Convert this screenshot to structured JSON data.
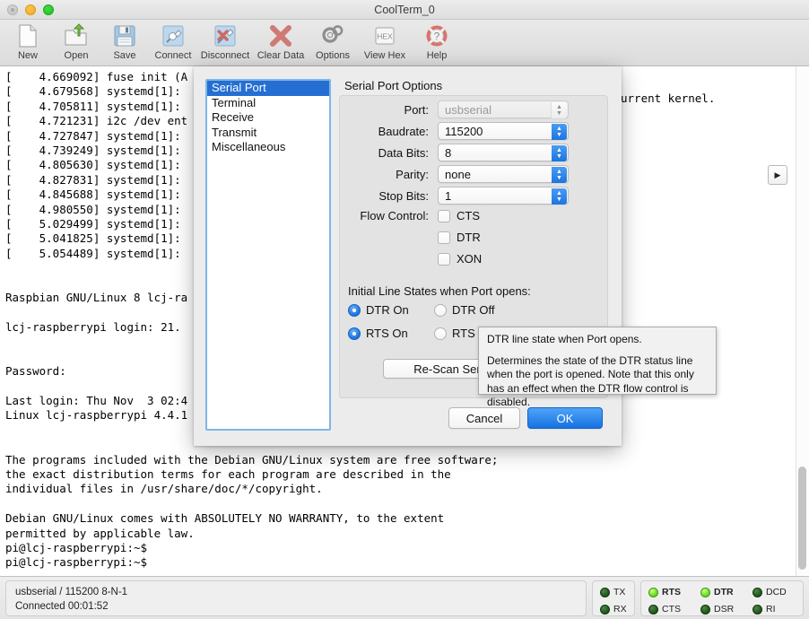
{
  "window": {
    "title": "CoolTerm_0",
    "controls": [
      "close-disabled",
      "minimize",
      "maximize"
    ]
  },
  "toolbar": {
    "items": [
      {
        "label": "New",
        "icon": "new-document-icon"
      },
      {
        "label": "Open",
        "icon": "open-folder-icon"
      },
      {
        "label": "Save",
        "icon": "floppy-disk-icon"
      },
      {
        "label": "Connect",
        "icon": "plug-connect-icon"
      },
      {
        "label": "Disconnect",
        "icon": "plug-disconnect-icon"
      },
      {
        "label": "Clear Data",
        "icon": "red-x-icon"
      },
      {
        "label": "Options",
        "icon": "gears-icon"
      },
      {
        "label": "View Hex",
        "icon": "hex-box-icon"
      },
      {
        "label": "Help",
        "icon": "lifebuoy-question-icon"
      }
    ]
  },
  "terminal": {
    "lines": [
      "[    4.669092] fuse init (A",
      "[    4.679568] systemd[1]:",
      "[    4.705811] systemd[1]:",
      "[    4.721231] i2c /dev ent",
      "[    4.727847] systemd[1]:",
      "[    4.739249] systemd[1]:",
      "[    4.805630] systemd[1]:",
      "[    4.827831] systemd[1]:",
      "[    4.845688] systemd[1]:",
      "[    4.980550] systemd[1]:",
      "[    5.029499] systemd[1]:",
      "[    5.041825] systemd[1]:",
      "[    5.054489] systemd[1]:",
      "",
      "",
      "Raspbian GNU/Linux 8 lcj-ra",
      "",
      "lcj-raspberrypi login: 21.",
      "",
      "",
      "Password:",
      "",
      "Last login: Thu Nov  3 02:4",
      "Linux lcj-raspberrypi 4.4.1",
      "",
      "",
      "The programs included with the Debian GNU/Linux system are free software;",
      "the exact distribution terms for each program are described in the",
      "individual files in /usr/share/doc/*/copyright.",
      "",
      "Debian GNU/Linux comes with ABSOLUTELY NO WARRANTY, to the extent",
      "permitted by applicable law.",
      "pi@lcj-raspberrypi:~$",
      "pi@lcj-raspberrypi:~$"
    ],
    "right_fragment": "urrent kernel."
  },
  "dialog": {
    "categories": [
      {
        "label": "Serial Port",
        "selected": true
      },
      {
        "label": "Terminal",
        "selected": false
      },
      {
        "label": "Receive",
        "selected": false
      },
      {
        "label": "Transmit",
        "selected": false
      },
      {
        "label": "Miscellaneous",
        "selected": false
      }
    ],
    "section_title": "Serial Port Options",
    "fields": {
      "port": {
        "label": "Port:",
        "value": "usbserial",
        "disabled": true
      },
      "baudrate": {
        "label": "Baudrate:",
        "value": "115200"
      },
      "data_bits": {
        "label": "Data Bits:",
        "value": "8"
      },
      "parity": {
        "label": "Parity:",
        "value": "none"
      },
      "stop_bits": {
        "label": "Stop Bits:",
        "value": "1"
      }
    },
    "flow_control": {
      "label": "Flow Control:",
      "options": [
        {
          "label": "CTS",
          "checked": false
        },
        {
          "label": "DTR",
          "checked": false
        },
        {
          "label": "XON",
          "checked": false
        }
      ]
    },
    "line_states": {
      "title": "Initial Line States when Port opens:",
      "rows": [
        {
          "on_label": "DTR On",
          "on_selected": true,
          "off_label": "DTR Off",
          "off_selected": false
        },
        {
          "on_label": "RTS On",
          "on_selected": true,
          "off_label": "RTS Off",
          "off_selected": false
        }
      ]
    },
    "rescan_label": "Re-Scan Serial Ports",
    "cancel_label": "Cancel",
    "ok_label": "OK",
    "arrow_button_icon": "right-triangle-icon"
  },
  "tooltip": {
    "line1": "DTR line state when Port opens.",
    "line2": "Determines the state of the DTR status line when the port is opened. Note that this only has an effect when the DTR flow control is disabled."
  },
  "statusbar": {
    "connection": "usbserial / 115200 8-N-1",
    "status": "Connected 00:01:52",
    "led_group_1": [
      {
        "label": "TX",
        "on": false
      },
      {
        "label": "RX",
        "on": false
      }
    ],
    "led_group_2": [
      {
        "label": "RTS",
        "on": true
      },
      {
        "label": "DTR",
        "on": true
      },
      {
        "label": "DCD",
        "on": false
      },
      {
        "label": "CTS",
        "on": false
      },
      {
        "label": "DSR",
        "on": false
      },
      {
        "label": "RI",
        "on": false
      }
    ]
  },
  "colors": {
    "accent": "#1672e3",
    "selection": "#256fd3",
    "led_on": "#5ed41c",
    "led_off": "#1d4d19"
  }
}
